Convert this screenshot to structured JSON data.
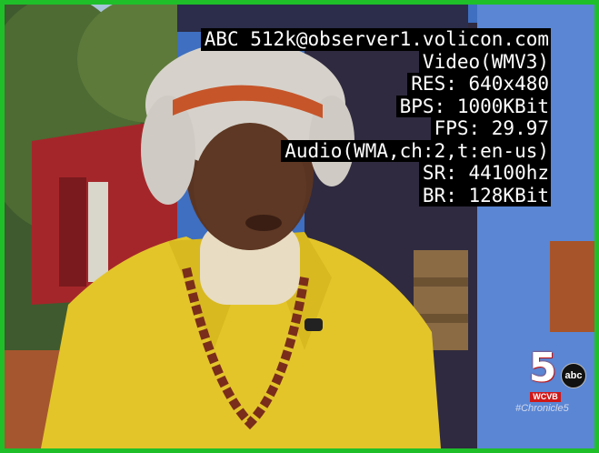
{
  "stream_info": {
    "source": "ABC 512k@observer1.volicon.com",
    "video_codec": "Video(WMV3)",
    "resolution": "RES: 640x480",
    "bitrate": "BPS: 1000KBit",
    "framerate": "FPS: 29.97",
    "audio_codec": "Audio(WMA,ch:2,t:en-us)",
    "sample_rate": "SR: 44100hz",
    "audio_bitrate": "BR: 128KBit"
  },
  "station_logo": {
    "channel": "5",
    "network": "abc",
    "call_sign": "WCVB",
    "hashtag": "#Chronicle5"
  },
  "colors": {
    "frame_border": "#1fbf2a",
    "overlay_bg": "#000000",
    "overlay_text": "#ffffff",
    "logo_red": "#d01818"
  }
}
